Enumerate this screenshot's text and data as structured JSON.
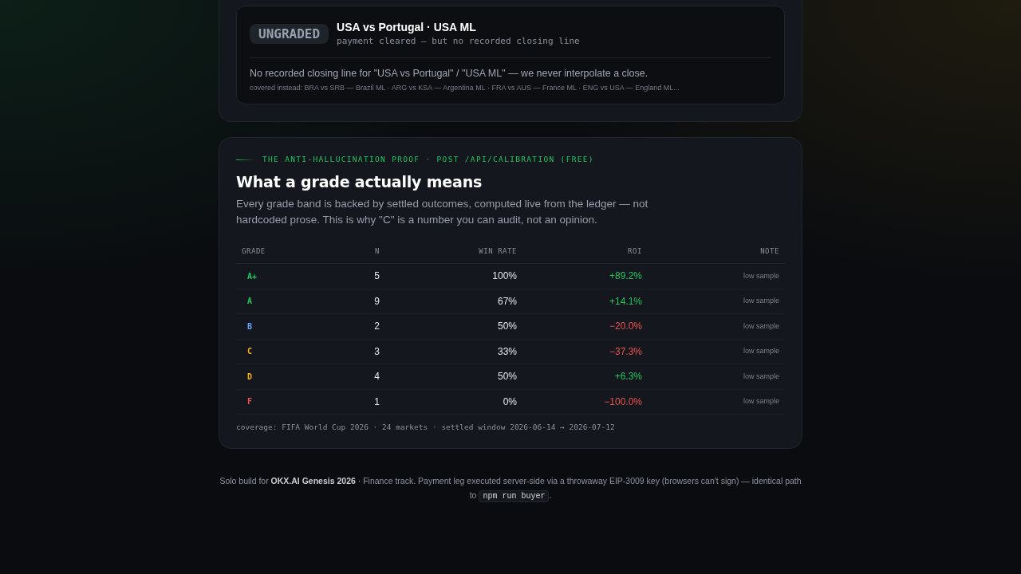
{
  "top_card": {
    "badge": "UNGRADED",
    "title": "USA vs Portugal · USA ML",
    "subtitle": "payment cleared — but no recorded closing line",
    "message": "No recorded closing line for \"USA vs Portugal\" / \"USA ML\" — we never interpolate a close.",
    "covered": "covered instead: BRA vs SRB — Brazil ML · ARG vs KSA — Argentina ML · FRA vs AUS — France ML · ENG vs USA — England ML..."
  },
  "calibration": {
    "eyebrow": "THE ANTI-HALLUCINATION PROOF · POST /API/CALIBRATION (FREE)",
    "title": "What a grade actually means",
    "description": "Every grade band is backed by settled outcomes, computed live from the ledger — not hardcoded prose. This is why \"C\" is a number you can audit, not an opinion.",
    "table": {
      "columns": [
        "GRADE",
        "N",
        "WIN RATE",
        "ROI",
        "NOTE"
      ],
      "rows": [
        {
          "grade": "A+",
          "color": "#22c55e",
          "n": "5",
          "win_rate": "100%",
          "roi": "+89.2%",
          "roi_positive": true,
          "note": "low sample"
        },
        {
          "grade": "A",
          "color": "#22c55e",
          "n": "9",
          "win_rate": "67%",
          "roi": "+14.1%",
          "roi_positive": true,
          "note": "low sample"
        },
        {
          "grade": "B",
          "color": "#60a5fa",
          "n": "2",
          "win_rate": "50%",
          "roi": "−20.0%",
          "roi_positive": false,
          "note": "low sample"
        },
        {
          "grade": "C",
          "color": "#f5b014",
          "n": "3",
          "win_rate": "33%",
          "roi": "−37.3%",
          "roi_positive": false,
          "note": "low sample"
        },
        {
          "grade": "D",
          "color": "#f5b014",
          "n": "4",
          "win_rate": "50%",
          "roi": "+6.3%",
          "roi_positive": true,
          "note": "low sample"
        },
        {
          "grade": "F",
          "color": "#ef5350",
          "n": "1",
          "win_rate": "0%",
          "roi": "−100.0%",
          "roi_positive": false,
          "note": "low sample"
        }
      ]
    },
    "coverage": "coverage: FIFA World Cup 2026 · 24 markets · settled window 2026-06-14 → 2026-07-12"
  },
  "footer": {
    "text": "Solo build for **OKX.AI Genesis 2026** · Finance track. Payment leg executed server-side via a throwaway EIP-3009 key (browsers can't sign) — identical path to",
    "command": "npm run buyer",
    "end": "."
  }
}
